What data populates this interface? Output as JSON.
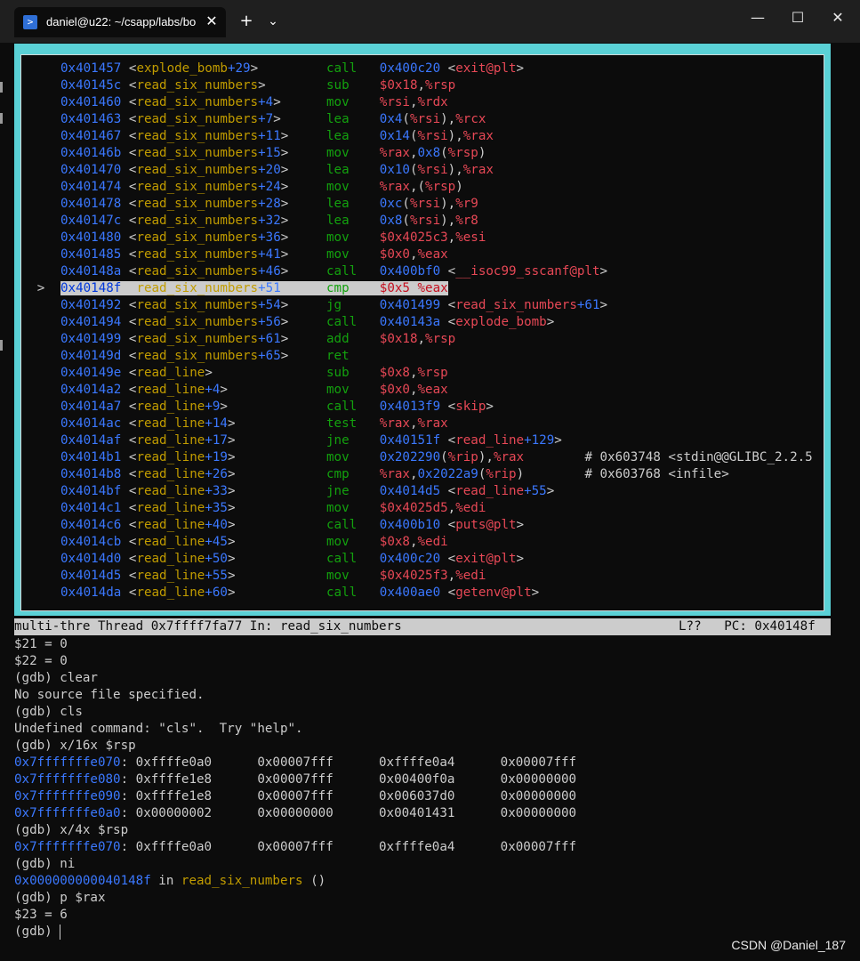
{
  "window": {
    "tab_title": "daniel@u22: ~/csapp/labs/bo",
    "new_tab": "+",
    "dropdown": "⌄",
    "close_tab": "✕",
    "minimize": "—",
    "maximize": "☐",
    "close": "✕"
  },
  "asm": [
    {
      "m": "",
      "a": "0x401457",
      "f": "explode_bomb",
      "o": "+29",
      "n": "call",
      "d": [
        [
          "0x400c20 ",
          "ad"
        ],
        [
          "<",
          "cm"
        ],
        [
          "exit@plt",
          "op"
        ],
        [
          ">",
          "cm"
        ]
      ]
    },
    {
      "m": "",
      "a": "0x40145c",
      "f": "read_six_numbers",
      "o": "",
      "n": "sub",
      "d": [
        [
          "$0x18",
          "op"
        ],
        [
          ",",
          "cm"
        ],
        [
          "%rsp",
          "op"
        ]
      ]
    },
    {
      "m": "",
      "a": "0x401460",
      "f": "read_six_numbers",
      "o": "+4",
      "n": "mov",
      "d": [
        [
          "%rsi",
          "op"
        ],
        [
          ",",
          "cm"
        ],
        [
          "%rdx",
          "op"
        ]
      ]
    },
    {
      "m": "",
      "a": "0x401463",
      "f": "read_six_numbers",
      "o": "+7",
      "n": "lea",
      "d": [
        [
          "0x4",
          "ad"
        ],
        [
          "(",
          "cm"
        ],
        [
          "%rsi",
          "op"
        ],
        [
          "),",
          "cm"
        ],
        [
          "%rcx",
          "op"
        ]
      ]
    },
    {
      "m": "",
      "a": "0x401467",
      "f": "read_six_numbers",
      "o": "+11",
      "n": "lea",
      "d": [
        [
          "0x14",
          "ad"
        ],
        [
          "(",
          "cm"
        ],
        [
          "%rsi",
          "op"
        ],
        [
          "),",
          "cm"
        ],
        [
          "%rax",
          "op"
        ]
      ]
    },
    {
      "m": "",
      "a": "0x40146b",
      "f": "read_six_numbers",
      "o": "+15",
      "n": "mov",
      "d": [
        [
          "%rax",
          "op"
        ],
        [
          ",",
          "cm"
        ],
        [
          "0x8",
          "ad"
        ],
        [
          "(",
          "cm"
        ],
        [
          "%rsp",
          "op"
        ],
        [
          ")",
          "cm"
        ]
      ]
    },
    {
      "m": "",
      "a": "0x401470",
      "f": "read_six_numbers",
      "o": "+20",
      "n": "lea",
      "d": [
        [
          "0x10",
          "ad"
        ],
        [
          "(",
          "cm"
        ],
        [
          "%rsi",
          "op"
        ],
        [
          "),",
          "cm"
        ],
        [
          "%rax",
          "op"
        ]
      ]
    },
    {
      "m": "",
      "a": "0x401474",
      "f": "read_six_numbers",
      "o": "+24",
      "n": "mov",
      "d": [
        [
          "%rax",
          "op"
        ],
        [
          ",(",
          "cm"
        ],
        [
          "%rsp",
          "op"
        ],
        [
          ")",
          "cm"
        ]
      ]
    },
    {
      "m": "",
      "a": "0x401478",
      "f": "read_six_numbers",
      "o": "+28",
      "n": "lea",
      "d": [
        [
          "0xc",
          "ad"
        ],
        [
          "(",
          "cm"
        ],
        [
          "%rsi",
          "op"
        ],
        [
          "),",
          "cm"
        ],
        [
          "%r9",
          "op"
        ]
      ]
    },
    {
      "m": "",
      "a": "0x40147c",
      "f": "read_six_numbers",
      "o": "+32",
      "n": "lea",
      "d": [
        [
          "0x8",
          "ad"
        ],
        [
          "(",
          "cm"
        ],
        [
          "%rsi",
          "op"
        ],
        [
          "),",
          "cm"
        ],
        [
          "%r8",
          "op"
        ]
      ]
    },
    {
      "m": "",
      "a": "0x401480",
      "f": "read_six_numbers",
      "o": "+36",
      "n": "mov",
      "d": [
        [
          "$0x4025c3",
          "op"
        ],
        [
          ",",
          "cm"
        ],
        [
          "%esi",
          "op"
        ]
      ]
    },
    {
      "m": "",
      "a": "0x401485",
      "f": "read_six_numbers",
      "o": "+41",
      "n": "mov",
      "d": [
        [
          "$0x0",
          "op"
        ],
        [
          ",",
          "cm"
        ],
        [
          "%eax",
          "op"
        ]
      ]
    },
    {
      "m": "",
      "a": "0x40148a",
      "f": "read_six_numbers",
      "o": "+46",
      "n": "call",
      "d": [
        [
          "0x400bf0 ",
          "ad"
        ],
        [
          "<",
          "cm"
        ],
        [
          "__isoc99_sscanf@plt",
          "op"
        ],
        [
          ">",
          "cm"
        ]
      ]
    },
    {
      "m": ">",
      "hl": true,
      "a": "0x40148f",
      "f": "read_six_numbers",
      "o": "+51",
      "n": "cmp",
      "d": [
        [
          "$0x5",
          "op"
        ],
        [
          ",",
          "cm"
        ],
        [
          "%eax",
          "op"
        ]
      ]
    },
    {
      "m": "",
      "a": "0x401492",
      "f": "read_six_numbers",
      "o": "+54",
      "n": "jg",
      "d": [
        [
          "0x401499 ",
          "ad"
        ],
        [
          "<",
          "cm"
        ],
        [
          "read_six_numbers",
          "op"
        ],
        [
          "+61",
          "ad"
        ],
        [
          ">",
          "cm"
        ]
      ]
    },
    {
      "m": "",
      "a": "0x401494",
      "f": "read_six_numbers",
      "o": "+56",
      "n": "call",
      "d": [
        [
          "0x40143a ",
          "ad"
        ],
        [
          "<",
          "cm"
        ],
        [
          "explode_bomb",
          "op"
        ],
        [
          ">",
          "cm"
        ]
      ]
    },
    {
      "m": "",
      "a": "0x401499",
      "f": "read_six_numbers",
      "o": "+61",
      "n": "add",
      "d": [
        [
          "$0x18",
          "op"
        ],
        [
          ",",
          "cm"
        ],
        [
          "%rsp",
          "op"
        ]
      ]
    },
    {
      "m": "",
      "a": "0x40149d",
      "f": "read_six_numbers",
      "o": "+65",
      "n": "ret",
      "d": []
    },
    {
      "m": "",
      "a": "0x40149e",
      "f": "read_line",
      "o": "",
      "n": "sub",
      "d": [
        [
          "$0x8",
          "op"
        ],
        [
          ",",
          "cm"
        ],
        [
          "%rsp",
          "op"
        ]
      ]
    },
    {
      "m": "",
      "a": "0x4014a2",
      "f": "read_line",
      "o": "+4",
      "n": "mov",
      "d": [
        [
          "$0x0",
          "op"
        ],
        [
          ",",
          "cm"
        ],
        [
          "%eax",
          "op"
        ]
      ]
    },
    {
      "m": "",
      "a": "0x4014a7",
      "f": "read_line",
      "o": "+9",
      "n": "call",
      "d": [
        [
          "0x4013f9 ",
          "ad"
        ],
        [
          "<",
          "cm"
        ],
        [
          "skip",
          "op"
        ],
        [
          ">",
          "cm"
        ]
      ]
    },
    {
      "m": "",
      "a": "0x4014ac",
      "f": "read_line",
      "o": "+14",
      "n": "test",
      "d": [
        [
          "%rax",
          "op"
        ],
        [
          ",",
          "cm"
        ],
        [
          "%rax",
          "op"
        ]
      ]
    },
    {
      "m": "",
      "a": "0x4014af",
      "f": "read_line",
      "o": "+17",
      "n": "jne",
      "d": [
        [
          "0x40151f ",
          "ad"
        ],
        [
          "<",
          "cm"
        ],
        [
          "read_line",
          "op"
        ],
        [
          "+129",
          "ad"
        ],
        [
          ">",
          "cm"
        ]
      ]
    },
    {
      "m": "",
      "a": "0x4014b1",
      "f": "read_line",
      "o": "+19",
      "n": "mov",
      "d": [
        [
          "0x202290",
          "ad"
        ],
        [
          "(",
          "cm"
        ],
        [
          "%rip",
          "op"
        ],
        [
          "),",
          "cm"
        ],
        [
          "%rax",
          "op"
        ],
        [
          "        # 0x603748 <stdin@@GLIBC_2.2.5",
          "cm"
        ]
      ]
    },
    {
      "m": "",
      "a": "0x4014b8",
      "f": "read_line",
      "o": "+26",
      "n": "cmp",
      "d": [
        [
          "%rax",
          "op"
        ],
        [
          ",",
          "cm"
        ],
        [
          "0x2022a9",
          "ad"
        ],
        [
          "(",
          "cm"
        ],
        [
          "%rip",
          "op"
        ],
        [
          ")",
          "cm"
        ],
        [
          "        # 0x603768 <infile>",
          "cm"
        ]
      ]
    },
    {
      "m": "",
      "a": "0x4014bf",
      "f": "read_line",
      "o": "+33",
      "n": "jne",
      "d": [
        [
          "0x4014d5 ",
          "ad"
        ],
        [
          "<",
          "cm"
        ],
        [
          "read_line",
          "op"
        ],
        [
          "+55",
          "ad"
        ],
        [
          ">",
          "cm"
        ]
      ]
    },
    {
      "m": "",
      "a": "0x4014c1",
      "f": "read_line",
      "o": "+35",
      "n": "mov",
      "d": [
        [
          "$0x4025d5",
          "op"
        ],
        [
          ",",
          "cm"
        ],
        [
          "%edi",
          "op"
        ]
      ]
    },
    {
      "m": "",
      "a": "0x4014c6",
      "f": "read_line",
      "o": "+40",
      "n": "call",
      "d": [
        [
          "0x400b10 ",
          "ad"
        ],
        [
          "<",
          "cm"
        ],
        [
          "puts@plt",
          "op"
        ],
        [
          ">",
          "cm"
        ]
      ]
    },
    {
      "m": "",
      "a": "0x4014cb",
      "f": "read_line",
      "o": "+45",
      "n": "mov",
      "d": [
        [
          "$0x8",
          "op"
        ],
        [
          ",",
          "cm"
        ],
        [
          "%edi",
          "op"
        ]
      ]
    },
    {
      "m": "",
      "a": "0x4014d0",
      "f": "read_line",
      "o": "+50",
      "n": "call",
      "d": [
        [
          "0x400c20 ",
          "ad"
        ],
        [
          "<",
          "cm"
        ],
        [
          "exit@plt",
          "op"
        ],
        [
          ">",
          "cm"
        ]
      ]
    },
    {
      "m": "",
      "a": "0x4014d5",
      "f": "read_line",
      "o": "+55",
      "n": "mov",
      "d": [
        [
          "$0x4025f3",
          "op"
        ],
        [
          ",",
          "cm"
        ],
        [
          "%edi",
          "op"
        ]
      ]
    },
    {
      "m": "",
      "a": "0x4014da",
      "f": "read_line",
      "o": "+60",
      "n": "call",
      "d": [
        [
          "0x400ae0 ",
          "ad"
        ],
        [
          "<",
          "cm"
        ],
        [
          "getenv@plt",
          "op"
        ],
        [
          ">",
          "cm"
        ]
      ]
    }
  ],
  "status": {
    "left": "multi-thre Thread 0x7ffff7fa77 In: read_six_numbers",
    "right": "L??   PC: 0x40148f"
  },
  "gdb": [
    [
      [
        "$21 = 0",
        ""
      ]
    ],
    [
      [
        "$22 = 0",
        ""
      ]
    ],
    [
      [
        "(gdb) clear",
        ""
      ]
    ],
    [
      [
        "No source file specified.",
        ""
      ]
    ],
    [
      [
        "(gdb) cls",
        ""
      ]
    ],
    [
      [
        "Undefined command: \"cls\".  Try \"help\".",
        ""
      ]
    ],
    [
      [
        "(gdb) x/16x $rsp",
        ""
      ]
    ],
    [
      [
        "0x7fffffffe070",
        "blue"
      ],
      [
        ": 0xffffe0a0      0x00007fff      0xffffe0a4      0x00007fff",
        ""
      ]
    ],
    [
      [
        "0x7fffffffe080",
        "blue"
      ],
      [
        ": 0xffffe1e8      0x00007fff      0x00400f0a      0x00000000",
        ""
      ]
    ],
    [
      [
        "0x7fffffffe090",
        "blue"
      ],
      [
        ": 0xffffe1e8      0x00007fff      0x006037d0      0x00000000",
        ""
      ]
    ],
    [
      [
        "0x7fffffffe0a0",
        "blue"
      ],
      [
        ": 0x00000002      0x00000000      0x00401431      0x00000000",
        ""
      ]
    ],
    [
      [
        "(gdb) x/4x $rsp",
        ""
      ]
    ],
    [
      [
        "0x7fffffffe070",
        "blue"
      ],
      [
        ": 0xffffe0a0      0x00007fff      0xffffe0a4      0x00007fff",
        ""
      ]
    ],
    [
      [
        "(gdb) ni",
        ""
      ]
    ],
    [
      [
        "0x000000000040148f",
        "blue"
      ],
      [
        " in ",
        ""
      ],
      [
        "read_six_numbers",
        "gold"
      ],
      [
        " ()",
        ""
      ]
    ],
    [
      [
        "(gdb) p $rax",
        ""
      ]
    ],
    [
      [
        "$23 = 6",
        ""
      ]
    ],
    [
      [
        "(gdb) ",
        ""
      ]
    ]
  ],
  "watermark": "CSDN @Daniel_187"
}
